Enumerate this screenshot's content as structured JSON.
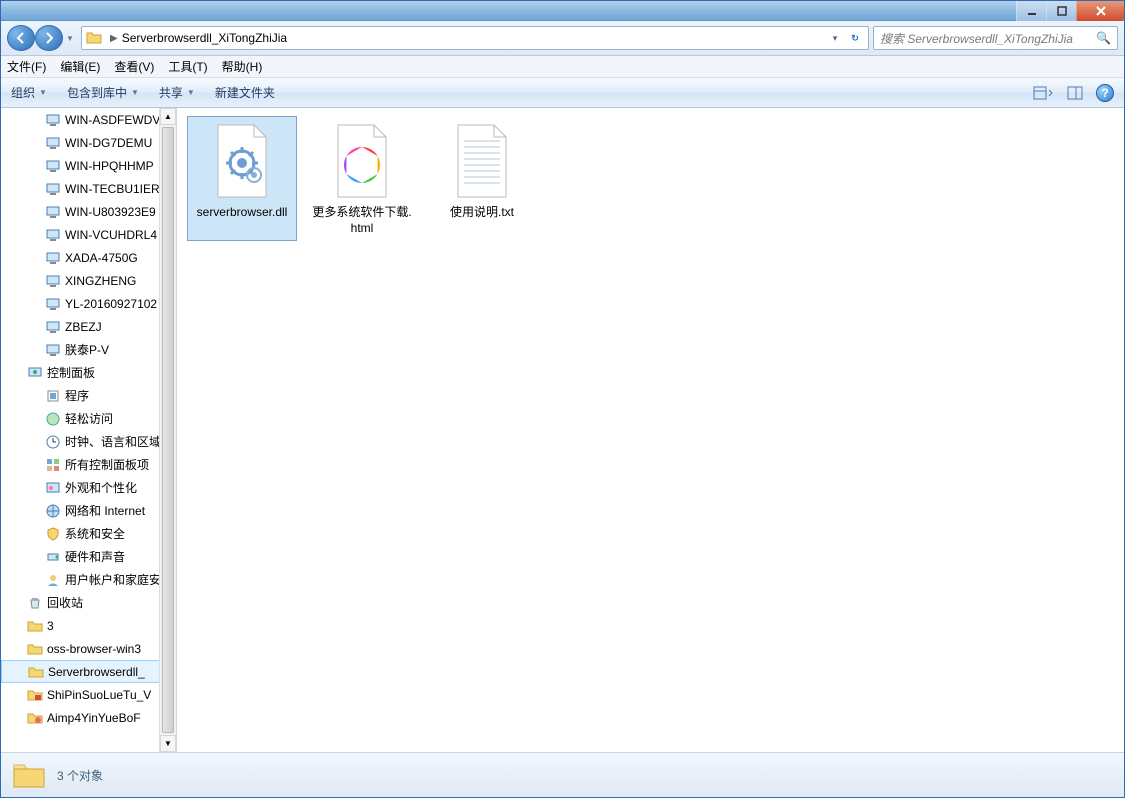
{
  "address": {
    "folder_name": "Serverbrowserdll_XiTongZhiJia"
  },
  "search": {
    "placeholder": "搜索 Serverbrowserdll_XiTongZhiJia"
  },
  "menu": {
    "file": "文件(F)",
    "edit": "编辑(E)",
    "view": "查看(V)",
    "tools": "工具(T)",
    "help": "帮助(H)"
  },
  "toolbar": {
    "organize": "组织",
    "include": "包含到库中",
    "share": "共享",
    "new_folder": "新建文件夹"
  },
  "tree": [
    {
      "label": "WIN-ASDFEWDV",
      "type": "pc",
      "lvl": 2
    },
    {
      "label": "WIN-DG7DEMU",
      "type": "pc",
      "lvl": 2
    },
    {
      "label": "WIN-HPQHHMP",
      "type": "pc",
      "lvl": 2
    },
    {
      "label": "WIN-TECBU1IER",
      "type": "pc",
      "lvl": 2
    },
    {
      "label": "WIN-U803923E9",
      "type": "pc",
      "lvl": 2
    },
    {
      "label": "WIN-VCUHDRL4",
      "type": "pc",
      "lvl": 2
    },
    {
      "label": "XADA-4750G",
      "type": "pc",
      "lvl": 2
    },
    {
      "label": "XINGZHENG",
      "type": "pc",
      "lvl": 2
    },
    {
      "label": "YL-20160927102",
      "type": "pc",
      "lvl": 2
    },
    {
      "label": "ZBEZJ",
      "type": "pc",
      "lvl": 2
    },
    {
      "label": "朕泰P-V",
      "type": "pc",
      "lvl": 2
    },
    {
      "label": "控制面板",
      "type": "cpl",
      "lvl": 1
    },
    {
      "label": "程序",
      "type": "cpl-prog",
      "lvl": 2
    },
    {
      "label": "轻松访问",
      "type": "cpl-ease",
      "lvl": 2
    },
    {
      "label": "时钟、语言和区域",
      "type": "cpl-clock",
      "lvl": 2
    },
    {
      "label": "所有控制面板项",
      "type": "cpl-all",
      "lvl": 2
    },
    {
      "label": "外观和个性化",
      "type": "cpl-appear",
      "lvl": 2
    },
    {
      "label": "网络和 Internet",
      "type": "cpl-net",
      "lvl": 2
    },
    {
      "label": "系统和安全",
      "type": "cpl-sys",
      "lvl": 2
    },
    {
      "label": "硬件和声音",
      "type": "cpl-hw",
      "lvl": 2
    },
    {
      "label": "用户帐户和家庭安",
      "type": "cpl-user",
      "lvl": 2
    },
    {
      "label": "回收站",
      "type": "recycle",
      "lvl": 1
    },
    {
      "label": "3",
      "type": "folder",
      "lvl": 1
    },
    {
      "label": "oss-browser-win3",
      "type": "folder",
      "lvl": 1
    },
    {
      "label": "Serverbrowserdll_",
      "type": "folder",
      "lvl": 1,
      "selected": true
    },
    {
      "label": "ShiPinSuoLueTu_V",
      "type": "folder-red",
      "lvl": 1
    },
    {
      "label": "Aimp4YinYueBoF",
      "type": "folder-icon",
      "lvl": 1
    }
  ],
  "files": [
    {
      "name": "serverbrowser.dll",
      "type": "dll",
      "selected": true
    },
    {
      "name": "更多系统软件下载.html",
      "type": "html"
    },
    {
      "name": "使用说明.txt",
      "type": "txt"
    }
  ],
  "status": {
    "text": "3 个对象"
  }
}
